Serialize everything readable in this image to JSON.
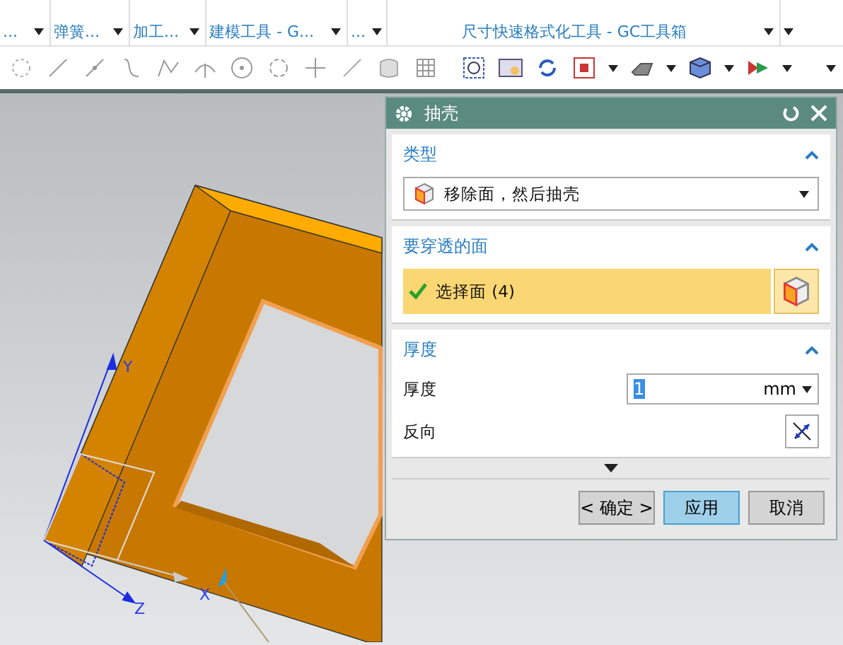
{
  "ribbon": {
    "groups": [
      {
        "label": "..."
      },
      {
        "label": "弹簧..."
      },
      {
        "label": "加工..."
      },
      {
        "label": "建模工具 - G..."
      },
      {
        "label": "..."
      },
      {
        "label": "尺寸快速格式化工具 - GC工具箱"
      }
    ]
  },
  "viewport": {
    "axes": [
      {
        "kind": "x",
        "label": "X"
      },
      {
        "kind": "y",
        "label": "Y"
      },
      {
        "kind": "z",
        "label": "Z"
      }
    ]
  },
  "dialog": {
    "title": "抽壳",
    "sections": [
      {
        "kind": "dropdown",
        "title": "类型",
        "expanded": true,
        "value": "移除面，然后抽壳"
      },
      {
        "kind": "selection",
        "title": "要穿透的面",
        "expanded": true,
        "label": "选择面 (4)",
        "checked": true
      },
      {
        "kind": "thickness",
        "title": "厚度",
        "expanded": true,
        "field_label": "厚度",
        "value": "1",
        "unit": "mm",
        "reverse_label": "反向"
      }
    ],
    "buttons": [
      {
        "label": "< 确定 >",
        "selected": false
      },
      {
        "label": "应用",
        "selected": true
      },
      {
        "label": "取消",
        "selected": false
      }
    ]
  }
}
